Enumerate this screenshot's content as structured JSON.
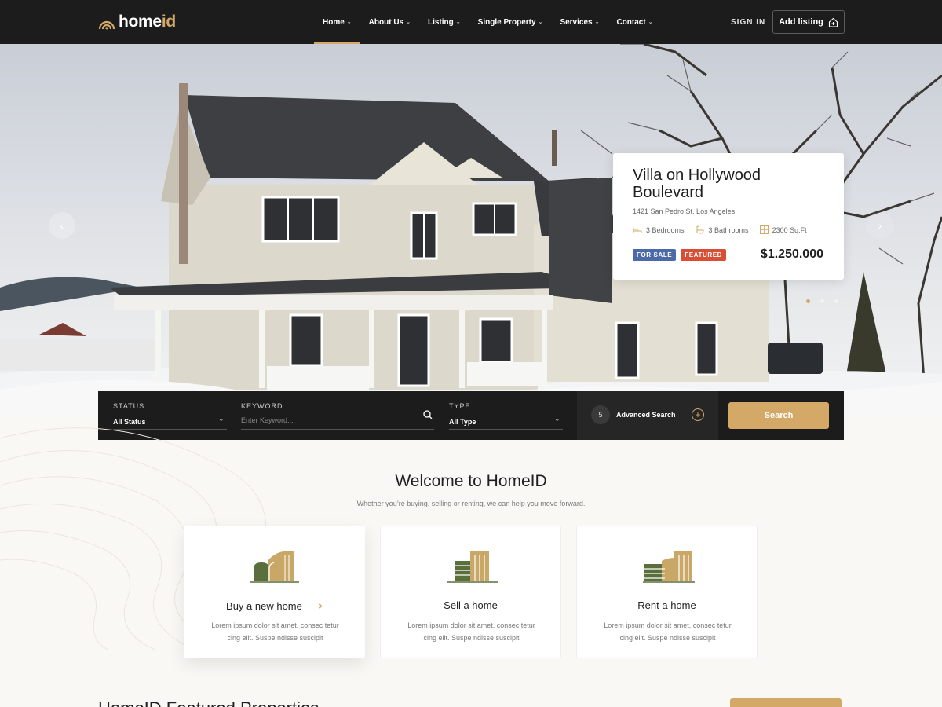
{
  "header": {
    "logo_home": "home",
    "logo_id": "id",
    "nav_items": [
      {
        "label": "Home",
        "active": true
      },
      {
        "label": "About Us",
        "active": false
      },
      {
        "label": "Listing",
        "active": false
      },
      {
        "label": "Single Property",
        "active": false
      },
      {
        "label": "Services",
        "active": false
      },
      {
        "label": "Contact",
        "active": false
      }
    ],
    "sign_in": "SIGN IN",
    "add_listing": "Add listing"
  },
  "hero": {
    "slide_count": 3,
    "active_slide": 1,
    "property": {
      "title": "Villa on Hollywood Boulevard",
      "address": "1421 San Pedro St, Los Angeles",
      "bedrooms": "3 Bedrooms",
      "bathrooms": "3 Bathrooms",
      "area": "2300 Sq.Ft",
      "badge_status": "FOR SALE",
      "badge_featured": "FEATURED",
      "price": "$1.250.000"
    }
  },
  "search": {
    "status_label": "STATUS",
    "status_value": "All Status",
    "keyword_label": "KEYWORD",
    "keyword_placeholder": "Enter Keyword...",
    "type_label": "TYPE",
    "type_value": "All Type",
    "advanced_count": "5",
    "advanced_label": "Advanced Search",
    "button": "Search"
  },
  "welcome": {
    "title": "Welcome to HomeID",
    "subtitle": "Whether you’re buying, selling or renting, we can help you move forward.",
    "services": [
      {
        "title": "Buy a new home",
        "desc": "Lorem ipsum dolor sit amet, consec tetur cing elit. Suspe ndisse suscipit"
      },
      {
        "title": "Sell a home",
        "desc": "Lorem ipsum dolor sit amet, consec tetur cing elit. Suspe ndisse suscipit"
      },
      {
        "title": "Rent a home",
        "desc": "Lorem ipsum dolor sit amet, consec tetur cing elit. Suspe ndisse suscipit"
      }
    ]
  },
  "featured": {
    "heading": "HomeID Featured Properties"
  },
  "colors": {
    "accent": "#d4a866",
    "dark": "#1c1c1c",
    "sale_badge": "#4d6aa8",
    "featured_badge": "#d94f35",
    "icon_green": "#5b6f3c"
  }
}
